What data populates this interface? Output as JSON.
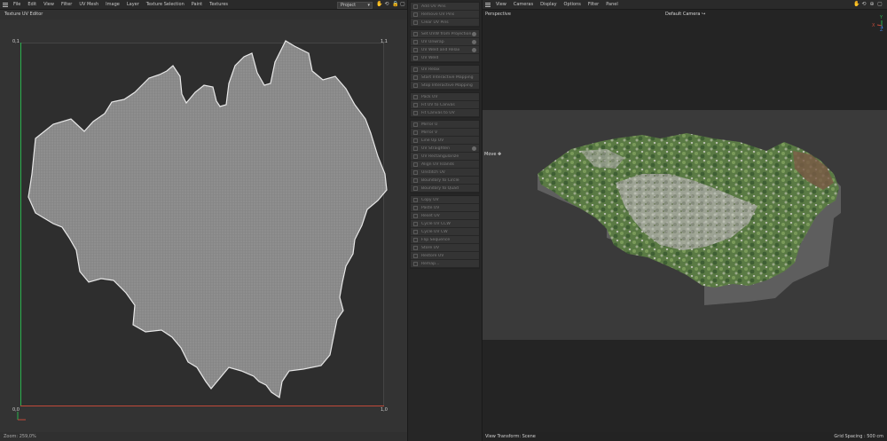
{
  "uv_editor": {
    "menu": [
      "File",
      "Edit",
      "View",
      "Filter",
      "UV Mesh",
      "Image",
      "Layer",
      "Texture Selection",
      "Paint",
      "Textures"
    ],
    "project_select": "Project",
    "title": "Texture UV Editor",
    "corners": {
      "top_left": "0,1",
      "top_right": "1,1",
      "bottom_left": "0,0",
      "bottom_right": "1,0"
    },
    "status": "Zoom: 259,0%"
  },
  "uv_commands": {
    "groups": [
      [
        "Add UV Pins",
        "Remove UV Pins",
        "Clear UV Pins"
      ],
      [
        "Set UVW from Projection",
        "UV Unwrap",
        "UV Weld and Relax",
        "UV Weld"
      ],
      [
        "UV Relax",
        "Start Interactive Mapping",
        "Stop Interactive Mapping"
      ],
      [
        "Pack UV",
        "Fit UV to Canvas",
        "Fit Canvas to UV"
      ],
      [
        "Mirror U",
        "Mirror V",
        "Line Up UV",
        "UV Straighten",
        "UV Rectangularize",
        "Align UV Islands",
        "Unstitch UV",
        "Boundary to Circle",
        "Boundary to Quad"
      ],
      [
        "Copy UV",
        "Paste UV",
        "Reset UV",
        "Cycle UV CCW",
        "Cycle UV CW",
        "Flip Sequence",
        "Store UV",
        "Restore UV",
        "Remap..."
      ]
    ],
    "gear_items": [
      "Set UVW from Projection",
      "UV Unwrap",
      "UV Weld and Relax",
      "UV Straighten"
    ]
  },
  "viewport": {
    "menu": [
      "View",
      "Cameras",
      "Display",
      "Options",
      "Filter",
      "Panel"
    ],
    "title": "Perspective",
    "camera": "Default Camera",
    "move_label": "Move",
    "view_transform": "View Transform: Scene",
    "grid_spacing": "Grid Spacing : 500 cm",
    "axis_labels": {
      "y": "Y",
      "x": "X",
      "z": "Z"
    }
  },
  "colors": {
    "u_axis": "#c04a3a",
    "v_axis": "#2ab04d",
    "uv_fill": "#8e8e8e"
  }
}
